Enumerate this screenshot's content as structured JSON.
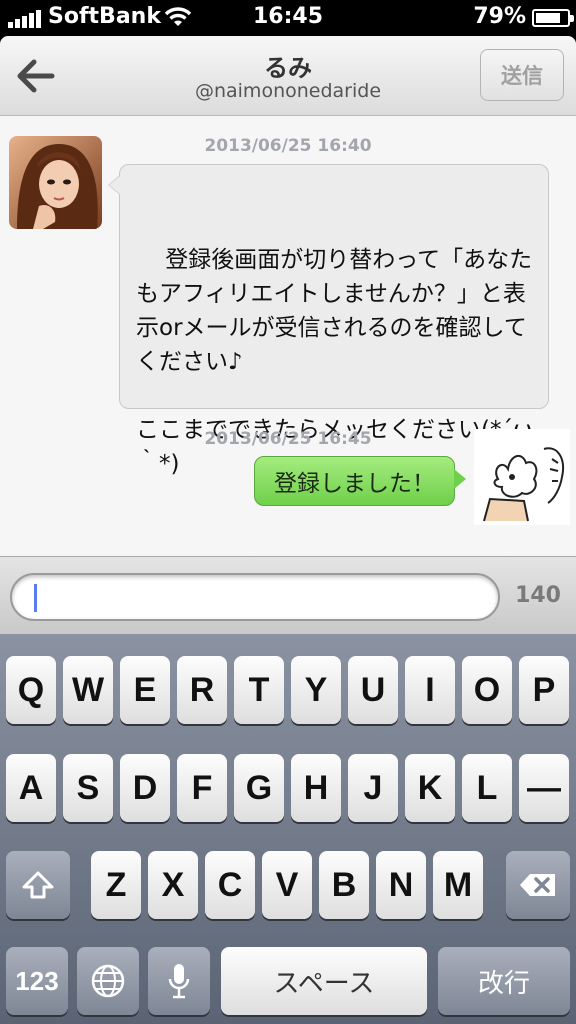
{
  "status_bar": {
    "carrier": "SoftBank",
    "time": "16:45",
    "battery_percent_text": "79%",
    "battery_level": 0.79,
    "signal_bars": 5
  },
  "nav": {
    "back_icon": "arrow-left-icon",
    "title": "るみ",
    "subtitle": "@naimononedaride",
    "send_label": "送信"
  },
  "messages": [
    {
      "timestamp": "2013/06/25 16:40",
      "direction": "incoming",
      "text": "登録後画面が切り替わって「あなたもアフィリエイトしませんか？」と表示orメールが受信されるのを確認してください♪\n\nここまでできたらメッセください(*´ω｀*)"
    },
    {
      "timestamp": "2013/06/25 16:45",
      "direction": "outgoing",
      "text": "登録しました！"
    }
  ],
  "composer": {
    "value": "",
    "char_count": "140"
  },
  "keyboard": {
    "row1": [
      "Q",
      "W",
      "E",
      "R",
      "T",
      "Y",
      "U",
      "I",
      "O",
      "P"
    ],
    "row2": [
      "A",
      "S",
      "D",
      "F",
      "G",
      "H",
      "J",
      "K",
      "L",
      "—"
    ],
    "row3": [
      "Z",
      "X",
      "C",
      "V",
      "B",
      "N",
      "M"
    ],
    "numbers_label": "123",
    "space_label": "スペース",
    "return_label": "改行",
    "icons": [
      "shift-icon",
      "backspace-icon",
      "globe-icon",
      "microphone-icon"
    ]
  },
  "colors": {
    "outgoing_bubble": "#7fdc55",
    "incoming_bubble": "#ececec",
    "cursor": "#5a7cf2"
  }
}
